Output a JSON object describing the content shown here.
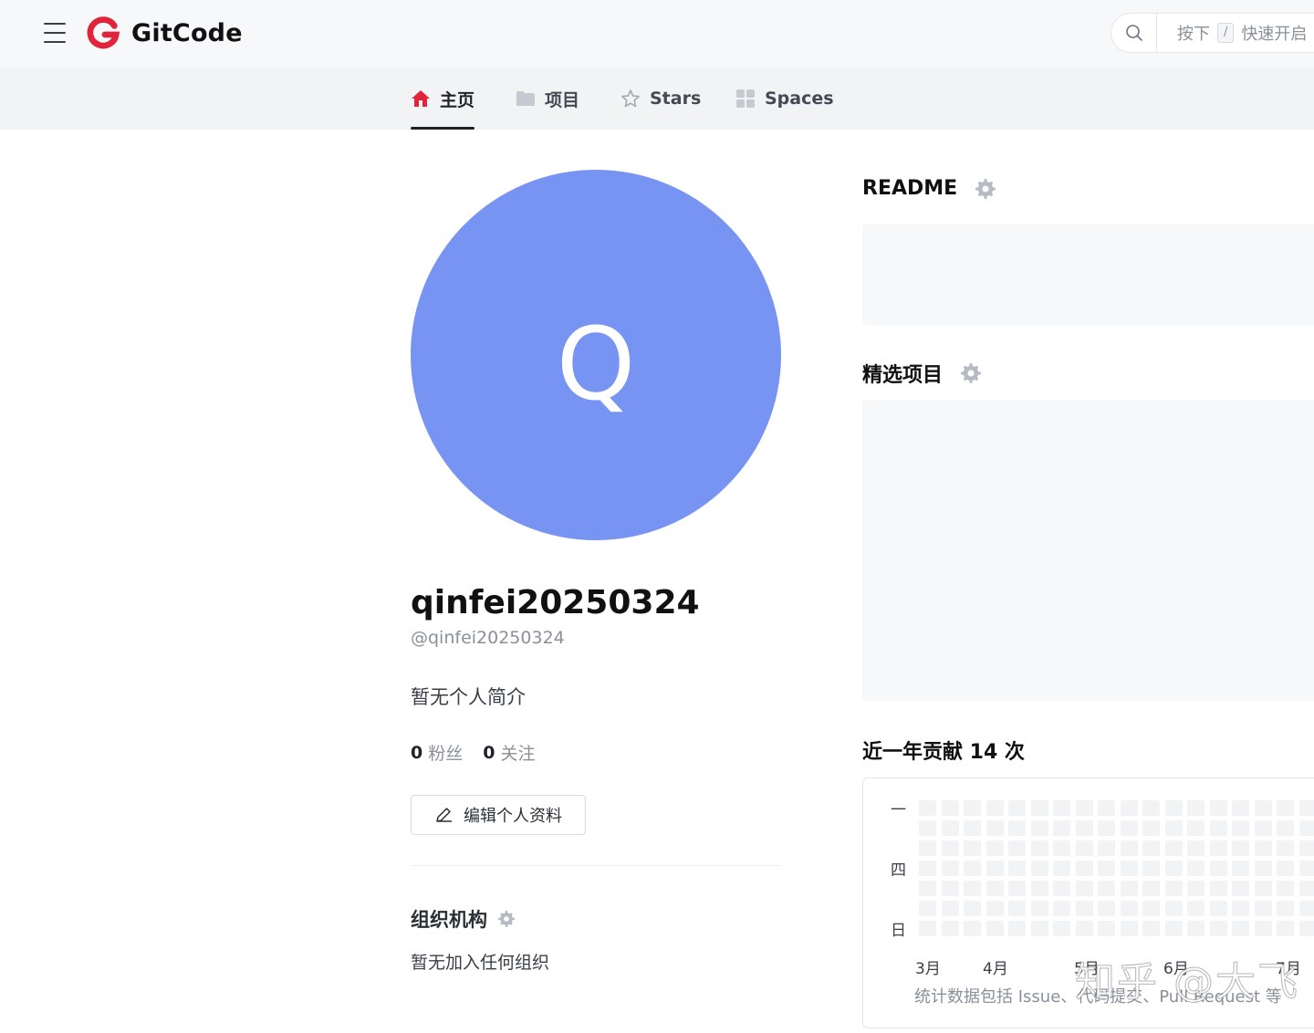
{
  "header": {
    "brand": "GitCode",
    "search": {
      "hint_prefix": "按下",
      "shortcut_key": "/",
      "hint_suffix": "快速开启"
    }
  },
  "nav": {
    "tabs": [
      {
        "label": "主页",
        "icon": "home-icon",
        "active": true
      },
      {
        "label": "项目",
        "icon": "folder-icon",
        "active": false
      },
      {
        "label": "Stars",
        "icon": "star-icon",
        "active": false
      },
      {
        "label": "Spaces",
        "icon": "grid-icon",
        "active": false
      }
    ]
  },
  "profile": {
    "avatar_initial": "Q",
    "avatar_color": "#7894f3",
    "display_name": "qinfei20250324",
    "handle": "@qinfei20250324",
    "bio": "暂无个人简介",
    "followers_count": "0",
    "followers_label": "粉丝",
    "following_count": "0",
    "following_label": "关注",
    "edit_button_label": "编辑个人资料"
  },
  "organizations": {
    "title": "组织机构",
    "empty_text": "暂无加入任何组织"
  },
  "readme": {
    "title": "README"
  },
  "featured": {
    "title": "精选项目"
  },
  "contributions": {
    "title": "近一年贡献 14 次",
    "weekday_labels": [
      "一",
      "四",
      "日"
    ],
    "months": [
      "3月",
      "4月",
      "5月",
      "6月",
      "7月"
    ],
    "note": "统计数据包括 Issue、代码提交、Pull Request 等"
  },
  "watermark": "知乎 @大飞",
  "colors": {
    "brand_red": "#e0243a",
    "accent_avatar": "#7894f3"
  }
}
